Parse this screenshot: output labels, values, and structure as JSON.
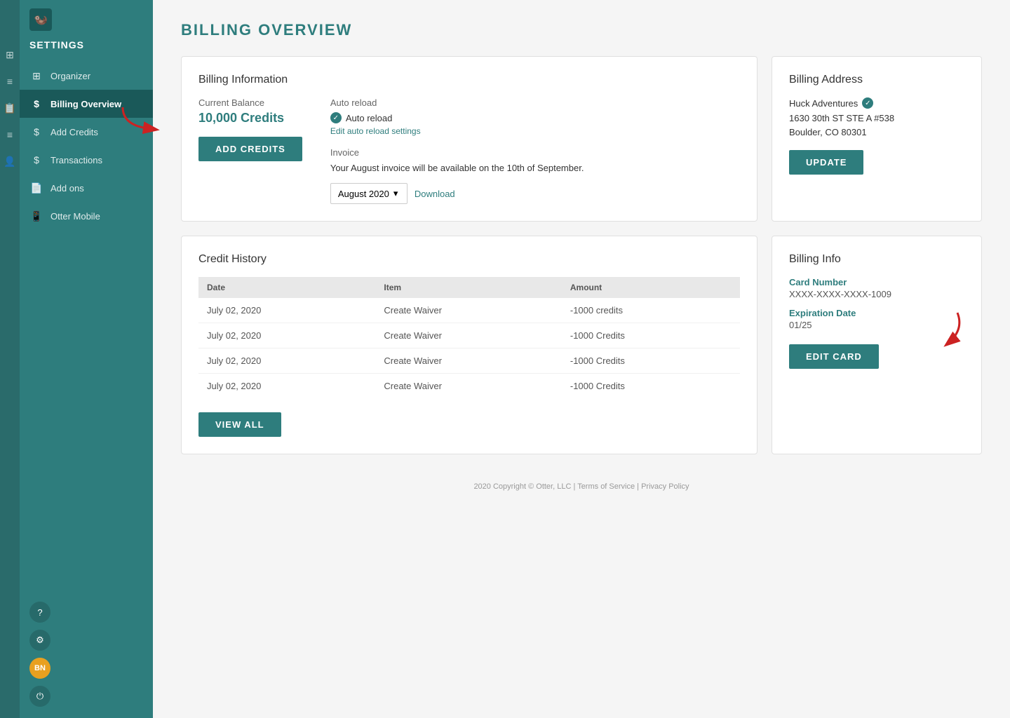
{
  "sidebar": {
    "title": "SETTINGS",
    "items": [
      {
        "id": "organizer",
        "label": "Organizer",
        "icon": "⊞"
      },
      {
        "id": "billing-overview",
        "label": "Billing Overview",
        "icon": "💲",
        "active": true
      },
      {
        "id": "add-credits",
        "label": "Add Credits",
        "icon": "💲"
      },
      {
        "id": "transactions",
        "label": "Transactions",
        "icon": "💲"
      },
      {
        "id": "add-ons",
        "label": "Add ons",
        "icon": "📄"
      },
      {
        "id": "otter-mobile",
        "label": "Otter Mobile",
        "icon": "⬜"
      }
    ],
    "bottom_icons": [
      {
        "id": "help",
        "icon": "?"
      },
      {
        "id": "settings",
        "icon": "⚙"
      },
      {
        "id": "user",
        "icon": "BN"
      },
      {
        "id": "power",
        "icon": "⏻"
      }
    ]
  },
  "iconbar": {
    "icons": [
      "⊞",
      "≡",
      "📋",
      "≡",
      "👤"
    ]
  },
  "page": {
    "title": "BILLING OVERVIEW"
  },
  "billing_info_card": {
    "title": "Billing Information",
    "current_balance_label": "Current Balance",
    "current_balance_value": "10,000 Credits",
    "add_credits_btn": "Add Credits",
    "auto_reload_label": "Auto reload",
    "auto_reload_status": "Auto reload",
    "edit_auto_reload_link": "Edit auto reload settings",
    "invoice_label": "Invoice",
    "invoice_note": "Your August invoice will be available on the 10th of September.",
    "invoice_month": "August 2020",
    "download_label": "Download"
  },
  "billing_address_card": {
    "title": "Billing Address",
    "company_name": "Huck Adventures",
    "address_line1": "1630 30th ST STE A #538",
    "address_line2": "Boulder, CO 80301",
    "update_btn": "UPDATE"
  },
  "credit_history_card": {
    "title": "Credit History",
    "columns": [
      "Date",
      "Item",
      "Amount"
    ],
    "rows": [
      {
        "date": "July 02, 2020",
        "item": "Create Waiver",
        "amount": "-1000 credits"
      },
      {
        "date": "July 02, 2020",
        "item": "Create Waiver",
        "amount": "-1000 Credits"
      },
      {
        "date": "July 02, 2020",
        "item": "Create Waiver",
        "amount": "-1000 Credits"
      },
      {
        "date": "July 02, 2020",
        "item": "Create Waiver",
        "amount": "-1000 Credits"
      }
    ],
    "view_all_btn": "VIEW ALL"
  },
  "billing_info_side_card": {
    "title": "Billing Info",
    "card_number_label": "Card Number",
    "card_number_value": "XXXX-XXXX-XXXX-1009",
    "expiration_label": "Expiration Date",
    "expiration_value": "01/25",
    "edit_card_btn": "EDIT CARD"
  },
  "footer": {
    "text": "2020 Copyright © Otter, LLC",
    "tos": "Terms of Service",
    "privacy": "Privacy Policy",
    "separator": "|"
  }
}
